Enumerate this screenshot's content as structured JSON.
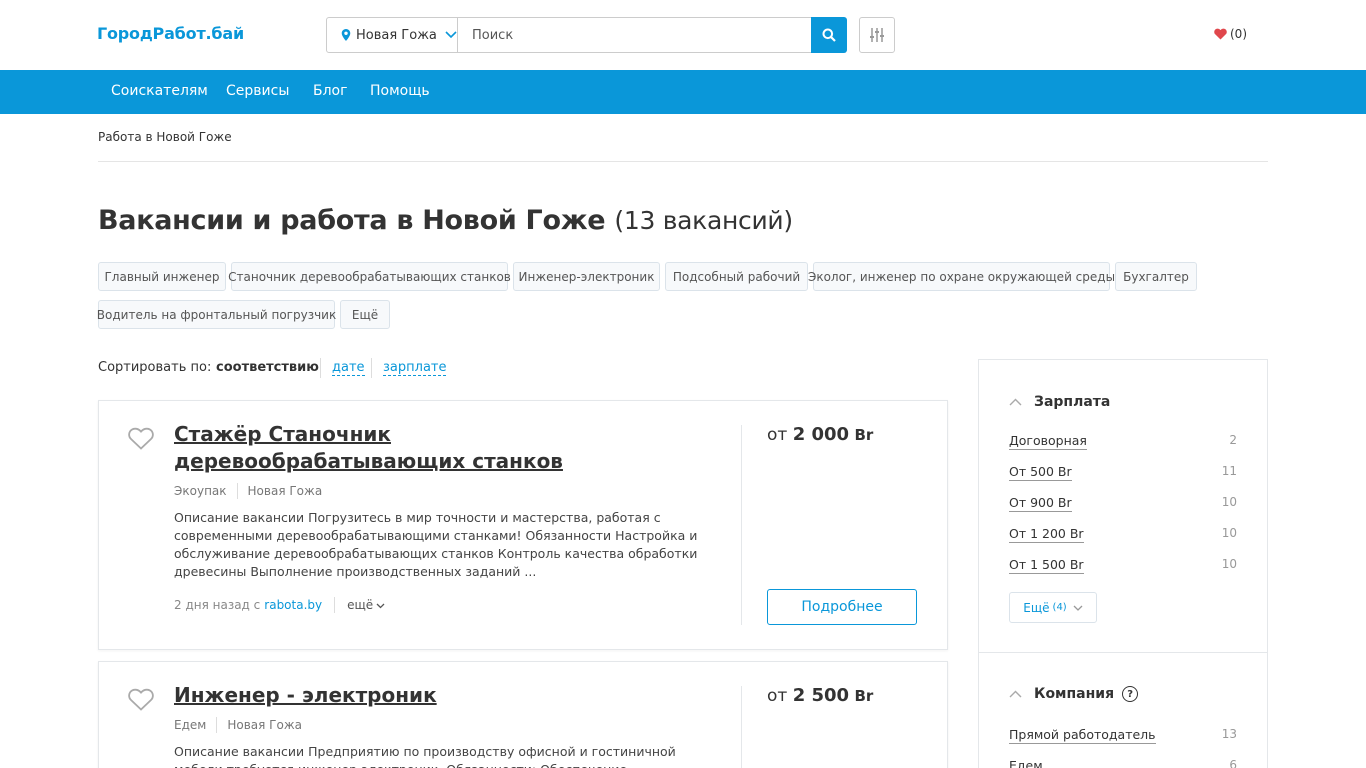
{
  "header": {
    "logo": "ГородРабот.бай",
    "location": "Новая Гожа",
    "search_placeholder": "Поиск",
    "favorites_count": "(0)"
  },
  "nav": {
    "items": [
      {
        "label": "Соискателям"
      },
      {
        "label": "Сервисы"
      },
      {
        "label": "Блог"
      },
      {
        "label": "Помощь"
      }
    ]
  },
  "breadcrumb": "Работа в Новой Гоже",
  "page": {
    "title": "Вакансии и работа в Новой Гоже",
    "count": "(13 вакансий)"
  },
  "tags": [
    {
      "label": "Главный инженер"
    },
    {
      "label": "Станочник деревообрабатывающих станков"
    },
    {
      "label": "Инженер-электроник"
    },
    {
      "label": "Подсобный рабочий"
    },
    {
      "label": "Эколог, инженер по охране окружающей среды"
    },
    {
      "label": "Бухгалтер"
    },
    {
      "label": "Водитель на фронтальный погрузчик"
    },
    {
      "label": "Ещё"
    }
  ],
  "sort": {
    "label": "Сортировать по:",
    "options": [
      {
        "label": "соответствию"
      },
      {
        "label": "дате"
      },
      {
        "label": "зарплате"
      }
    ]
  },
  "vacancies": [
    {
      "title": "Стажёр Станочник деревообрабатывающих станков",
      "company": "Экоупак",
      "city": "Новая Гожа",
      "description": "Описание вакансии Погрузитесь в мир точности и мастерства, работая с современными деревообрабатывающими станками! Обязанности Настройка и обслуживание деревообрабатывающих станков Контроль качества обработки древесины Выполнение производственных заданий ...",
      "salary_prefix": "от",
      "salary_value": "2 000",
      "salary_currency": "Br",
      "posted": "2 дня назад с",
      "source": "rabota.by",
      "more": "ещё",
      "details_button": "Подробнее"
    },
    {
      "title": "Инженер - электроник",
      "company": "Едем",
      "city": "Новая Гожа",
      "description": "Описание вакансии Предприятию по производству офисной и гостиничной мебели требуется инженер-электроник. Обязанности: Обеспечение бесперебойного",
      "salary_prefix": "от",
      "salary_value": "2 500",
      "salary_currency": "Br"
    }
  ],
  "sidebar": {
    "salary": {
      "heading": "Зарплата",
      "items": [
        {
          "label": "Договорная",
          "count": "2"
        },
        {
          "label": "От 500 Br",
          "count": "11"
        },
        {
          "label": "От 900 Br",
          "count": "10"
        },
        {
          "label": "От 1 200 Br",
          "count": "10"
        },
        {
          "label": "От 1 500 Br",
          "count": "10"
        }
      ],
      "more_label": "Ещё",
      "more_count": "(4)"
    },
    "company": {
      "heading": "Компания",
      "help": "?",
      "items": [
        {
          "label": "Прямой работодатель",
          "count": "13"
        },
        {
          "label": "Едем",
          "count": "6"
        }
      ]
    }
  },
  "colors": {
    "brand": "#0a97d9",
    "favorite": "#e0474c"
  }
}
